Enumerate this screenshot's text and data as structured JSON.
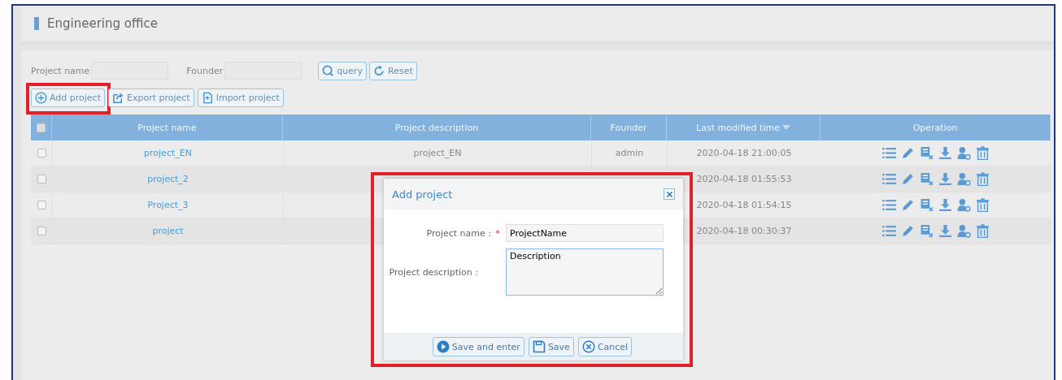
{
  "page_title": "Engineering office",
  "filters": [
    {
      "label": "Project name"
    },
    {
      "label": "Founder"
    }
  ],
  "filter_buttons": [
    {
      "kind": "query",
      "label": "query"
    },
    {
      "kind": "reset",
      "label": "Reset"
    }
  ],
  "toolbar": [
    {
      "kind": "add",
      "label": "Add project",
      "highlighted": true
    },
    {
      "kind": "export",
      "label": "Export project",
      "highlighted": false
    },
    {
      "kind": "import",
      "label": "Import project",
      "highlighted": false
    }
  ],
  "table": {
    "select_all": false,
    "columns": [
      {
        "label": "Project name",
        "sorted": false
      },
      {
        "label": "Project description",
        "sorted": false
      },
      {
        "label": "Founder",
        "sorted": false
      },
      {
        "label": "Last modified time",
        "sorted": true
      },
      {
        "label": "Operation",
        "sorted": false
      }
    ],
    "rows": [
      {
        "checked": false,
        "name": "project_EN",
        "description": "project_EN",
        "founder": "admin",
        "modified": "2020-04-18 21:00:05"
      },
      {
        "checked": false,
        "name": "project_2",
        "modified": "2020-04-18 01:55:53"
      },
      {
        "checked": false,
        "name": "Project_3",
        "modified": "2020-04-18 01:54:15"
      },
      {
        "checked": false,
        "name": "project",
        "modified": "2020-04-18 00:30:37"
      }
    ],
    "operations_shown": true
  },
  "dialog": {
    "title": "Add project",
    "highlighted": true,
    "fields": [
      {
        "kind": "input",
        "label": "Project name :",
        "required_mark": "*",
        "value": "ProjectName"
      },
      {
        "kind": "textarea",
        "label": "Project description :",
        "value": "Description"
      }
    ],
    "buttons": [
      {
        "kind": "save-enter",
        "label": "Save and enter"
      },
      {
        "kind": "save",
        "label": "Save"
      },
      {
        "kind": "cancel",
        "label": "Cancel"
      }
    ]
  }
}
